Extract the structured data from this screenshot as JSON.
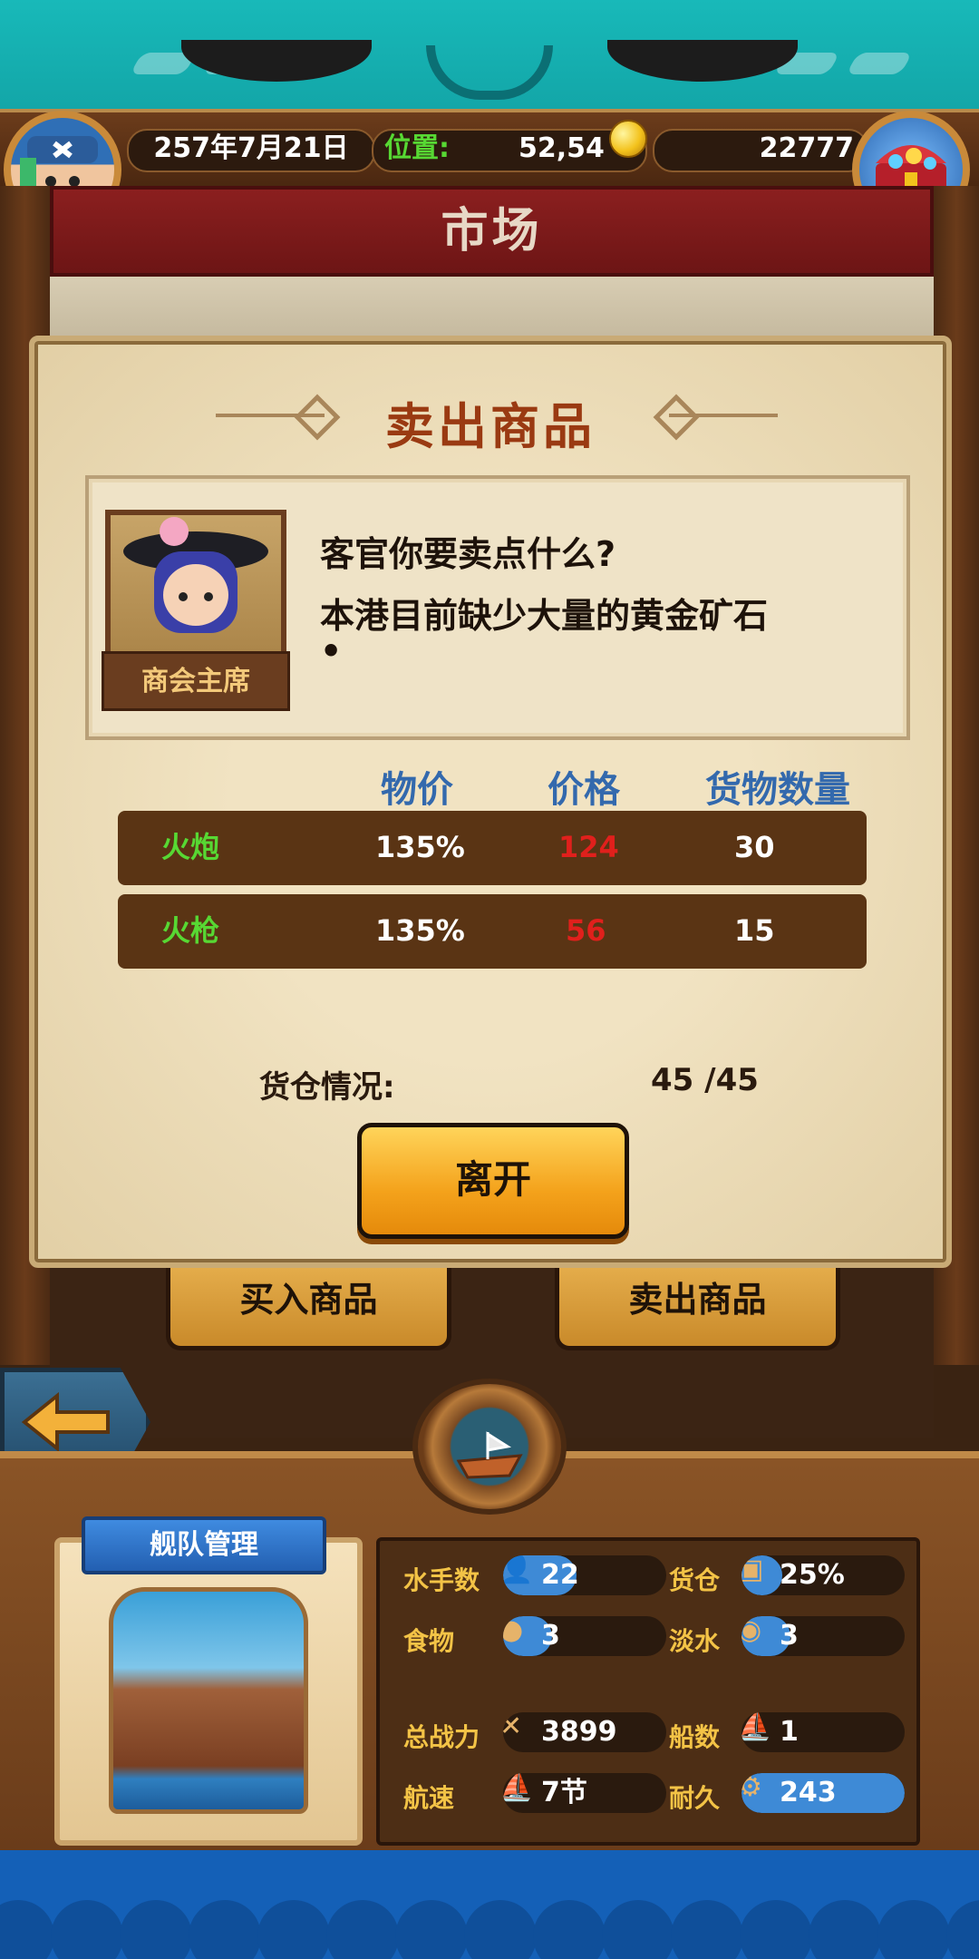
{
  "header": {
    "date": "257年7月21日",
    "position_label": "位置:",
    "position_value": "52,54",
    "gold": "22777"
  },
  "title": "市场",
  "dialog": {
    "title": "卖出商品",
    "npc_role": "商会主席",
    "line1": "客官你要卖点什么?",
    "line2": "本港目前缺少大量的黄金矿石",
    "line3": "•",
    "columns": [
      "物价",
      "价格",
      "货物数量"
    ],
    "rows": [
      {
        "name": "火炮",
        "price_index": "135%",
        "price": "124",
        "quantity": "30"
      },
      {
        "name": "火枪",
        "price_index": "135%",
        "price": "56",
        "quantity": "15"
      }
    ],
    "cargo_label": "货仓情况:",
    "cargo_value": "45 /45",
    "leave_button": "离开"
  },
  "trade": {
    "buy": "买入商品",
    "sell": "卖出商品"
  },
  "fleet": {
    "title": "舰队管理",
    "stats": [
      {
        "label": "水手数",
        "value": "22",
        "icon": "sailor-icon",
        "level": 0.45
      },
      {
        "label": "货仓",
        "value": "25%",
        "icon": "crate-icon",
        "level": 0.25
      },
      {
        "label": "食物",
        "value": "3",
        "icon": "meat-icon",
        "level": 0.3
      },
      {
        "label": "淡水",
        "value": "3",
        "icon": "water-icon",
        "level": 0.3
      },
      {
        "label": "总战力",
        "value": "3899",
        "icon": "swords-icon",
        "level": 0.0
      },
      {
        "label": "船数",
        "value": "1",
        "icon": "ship-icon",
        "level": 0.0
      },
      {
        "label": "航速",
        "value": "7节",
        "icon": "sail-icon",
        "level": 0.0
      },
      {
        "label": "耐久",
        "value": "243",
        "icon": "durability-icon",
        "level": 1.0
      }
    ]
  },
  "colors": {
    "accent_blue": "#3369ad",
    "price_red": "#e0201c",
    "item_green": "#57d833",
    "button_orange": "#f4a21b"
  }
}
